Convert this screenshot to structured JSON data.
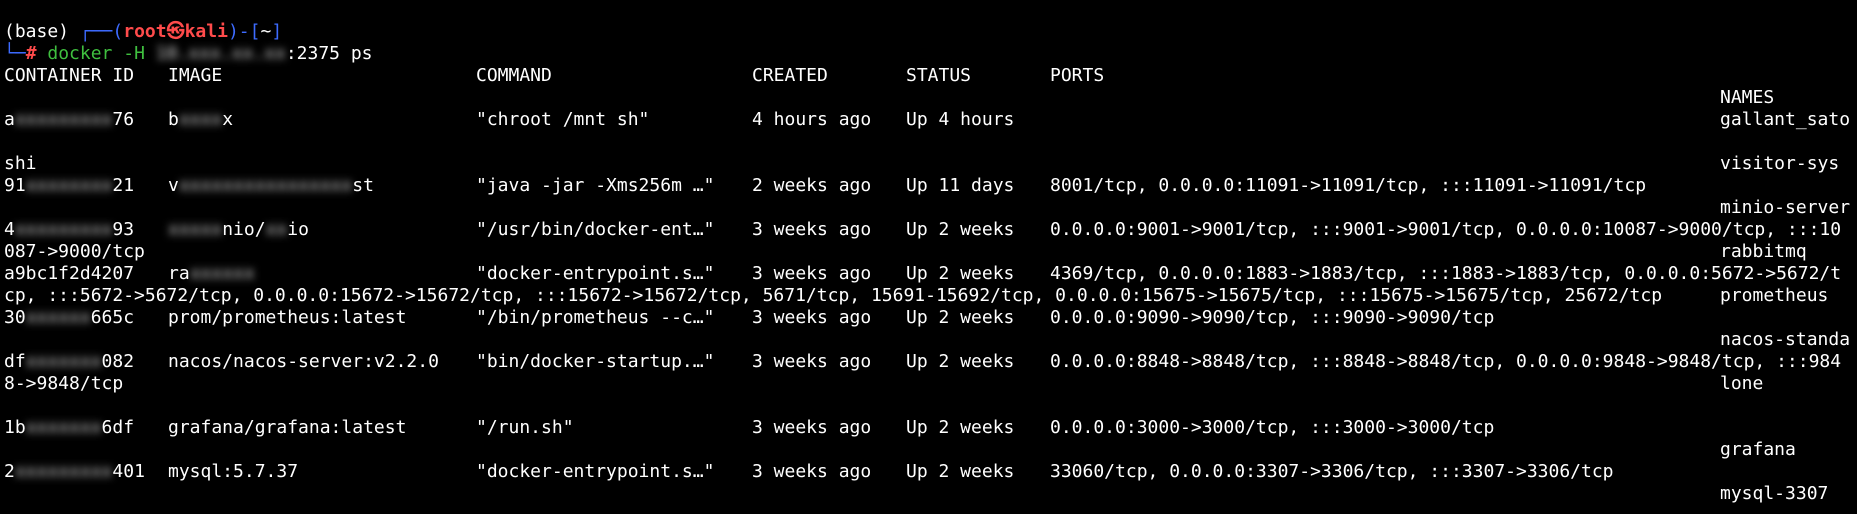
{
  "prompt": {
    "env": "(base)",
    "frame_open": "┌──(",
    "user": "root",
    "skull": "㉿",
    "host": "kali",
    "frame_close": ")-[",
    "cwd": "~",
    "bracket_close": "]",
    "second_line_prefix": "└─",
    "hash": "#",
    "command": "docker -H",
    "host_masked": "10.xxx.xx.xx",
    "port_cmd": ":2375 ps"
  },
  "table": {
    "headers": {
      "container_id": "CONTAINER ID",
      "image": "IMAGE",
      "command": "COMMAND",
      "created": "CREATED",
      "status": "STATUS",
      "ports": "PORTS",
      "names": "NAMES"
    },
    "rows": [
      {
        "id_start": "a",
        "id_mask": "xxxxxxxxx",
        "id_end": "76",
        "image_start": "b",
        "image_mask": "xxxx",
        "image_end": "x",
        "command": "\"chroot /mnt sh\"",
        "created": "4 hours ago",
        "status": "Up 4 hours",
        "ports": "",
        "ports_cont": "",
        "name": "gallant_sato",
        "name_cont": "shi"
      },
      {
        "id_start": "91",
        "id_mask": "xxxxxxxx",
        "id_end": "21",
        "image_start": "v",
        "image_mask": "xxxxxxxxxxxxxxxx",
        "image_end": "st",
        "command": "\"java -jar -Xms256m …\"",
        "created": "2 weeks ago",
        "status": "Up 11 days",
        "ports": "8001/tcp, 0.0.0.0:11091->11091/tcp, :::11091->11091/tcp",
        "ports_cont": "",
        "name": "visitor-sys",
        "name_cont": ""
      },
      {
        "id_start": "4",
        "id_mask": "xxxxxxxxx",
        "id_end": "93",
        "image_start": "",
        "image_mask": "xxxxx",
        "image_end": "nio/",
        "image_mask2": "xx",
        "image_end2": "io",
        "command": "\"/usr/bin/docker-ent…\"",
        "created": "3 weeks ago",
        "status": "Up 2 weeks",
        "ports": "0.0.0.0:9001->9001/tcp, :::9001->9001/tcp, 0.0.0.0:10087->9000/tcp, :::10",
        "ports_cont": "087->9000/tcp",
        "name": "minio-server",
        "name_cont": ""
      },
      {
        "id_start": "a9bc1f2d4207",
        "id_mask": "",
        "id_end": "",
        "image_start": "ra",
        "image_mask": "xxxxxx",
        "image_end": "",
        "command": "\"docker-entrypoint.s…\"",
        "created": "3 weeks ago",
        "status": "Up 2 weeks",
        "ports": "4369/tcp, 0.0.0.0:1883->1883/tcp, :::1883->1883/tcp, 0.0.0.0:5672->5672/t",
        "ports_cont": "cp, :::5672->5672/tcp, 0.0.0.0:15672->15672/tcp, :::15672->15672/tcp, 5671/tcp, 15691-15692/tcp, 0.0.0.0:15675->15675/tcp, :::15675->15675/tcp, 25672/tcp",
        "name": "rabbitmq",
        "name_cont": ""
      },
      {
        "id_start": "30",
        "id_mask": "xxxxxx",
        "id_end": "665c",
        "image_start": "prom/prometheus:latest",
        "image_mask": "",
        "image_end": "",
        "command": "\"/bin/prometheus --c…\"",
        "created": "3 weeks ago",
        "status": "Up 2 weeks",
        "ports": "0.0.0.0:9090->9090/tcp, :::9090->9090/tcp",
        "ports_cont": "",
        "name": "prometheus",
        "name_cont": ""
      },
      {
        "id_start": "df",
        "id_mask": "xxxxxxx",
        "id_end": "082",
        "image_start": "nacos/nacos-server:v2.2.0",
        "image_mask": "",
        "image_end": "",
        "command": "\"bin/docker-startup.…\"",
        "created": "3 weeks ago",
        "status": "Up 2 weeks",
        "ports": "0.0.0.0:8848->8848/tcp, :::8848->8848/tcp, 0.0.0.0:9848->9848/tcp, :::984",
        "ports_cont": "8->9848/tcp",
        "name": "nacos-standa",
        "name_cont": "lone"
      },
      {
        "id_start": "1b",
        "id_mask": "xxxxxxx",
        "id_end": "6df",
        "image_start": "grafana/grafana:latest",
        "image_mask": "",
        "image_end": "",
        "command": "\"/run.sh\"",
        "created": "3 weeks ago",
        "status": "Up 2 weeks",
        "ports": "0.0.0.0:3000->3000/tcp, :::3000->3000/tcp",
        "ports_cont": "",
        "name": "grafana",
        "name_cont": ""
      },
      {
        "id_start": "2",
        "id_mask": "xxxxxxxxx",
        "id_end": "401",
        "image_start": "mysql:5.7.37",
        "image_mask": "",
        "image_end": "",
        "command": "\"docker-entrypoint.s…\"",
        "created": "3 weeks ago",
        "status": "Up 2 weeks",
        "ports": "33060/tcp, 0.0.0.0:3307->3306/tcp, :::3307->3306/tcp",
        "ports_cont": "",
        "name": "mysql-3307",
        "name_cont": ""
      }
    ]
  }
}
